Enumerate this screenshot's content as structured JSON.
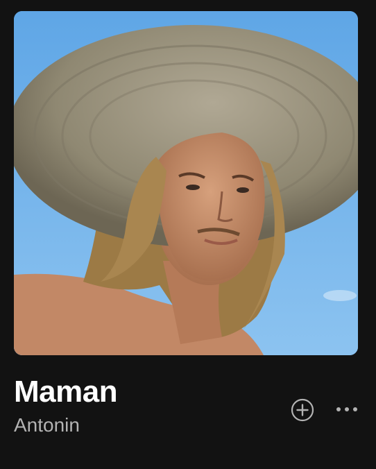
{
  "track": {
    "title": "Maman",
    "artist": "Antonin"
  },
  "actions": {
    "add_icon": "plus-circle-icon",
    "more_icon": "ellipsis-icon"
  },
  "colors": {
    "background": "#121212",
    "title": "#ffffff",
    "subtitle": "#b3b3b3",
    "icon": "#b3b3b3"
  }
}
